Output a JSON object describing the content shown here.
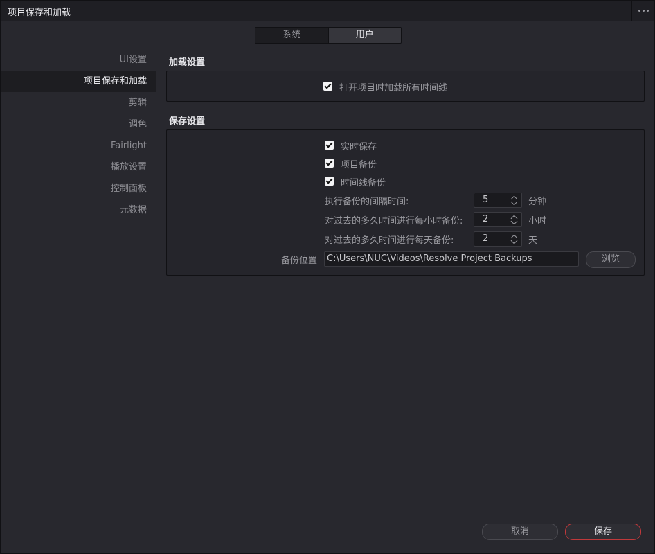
{
  "window": {
    "title": "项目保存和加载"
  },
  "tabs": [
    {
      "label": "系统"
    },
    {
      "label": "用户"
    }
  ],
  "sidebar": {
    "items": [
      {
        "label": "UI设置"
      },
      {
        "label": "项目保存和加载"
      },
      {
        "label": "剪辑"
      },
      {
        "label": "调色"
      },
      {
        "label": "Fairlight"
      },
      {
        "label": "播放设置"
      },
      {
        "label": "控制面板"
      },
      {
        "label": "元数据"
      }
    ]
  },
  "load": {
    "title": "加载设置",
    "load_all_timelines": {
      "label": "打开项目时加载所有时间线",
      "checked": true
    }
  },
  "save": {
    "title": "保存设置",
    "live_save": {
      "label": "实时保存",
      "checked": true
    },
    "project_backup": {
      "label": "项目备份",
      "checked": true
    },
    "timeline_backup": {
      "label": "时间线备份",
      "checked": true
    },
    "interval": {
      "label": "执行备份的间隔时间:",
      "value": "5",
      "unit": "分钟"
    },
    "hourly": {
      "label": "对过去的多久时间进行每小时备份:",
      "value": "2",
      "unit": "小时"
    },
    "daily": {
      "label": "对过去的多久时间进行每天备份:",
      "value": "2",
      "unit": "天"
    },
    "location": {
      "label": "备份位置",
      "value": "C:\\Users\\NUC\\Videos\\Resolve Project Backups",
      "browse": "浏览"
    }
  },
  "footer": {
    "cancel": "取消",
    "save": "保存"
  },
  "colors": {
    "accent_border": "#c0393b",
    "background": "#28282e"
  }
}
